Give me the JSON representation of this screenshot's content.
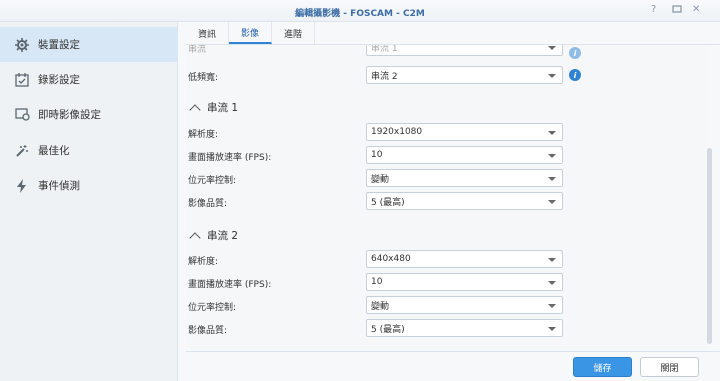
{
  "window": {
    "title": "編輯攝影機 - FOSCAM - C2M",
    "help": "?",
    "minimize": "—",
    "close": "✕"
  },
  "sidebar": {
    "items": [
      {
        "label": "裝置設定",
        "icon": "gear-icon",
        "active": true
      },
      {
        "label": "錄影設定",
        "icon": "calendar-check-icon",
        "active": false
      },
      {
        "label": "即時影像設定",
        "icon": "live-view-icon",
        "active": false
      },
      {
        "label": "最佳化",
        "icon": "magic-wand-icon",
        "active": false
      },
      {
        "label": "事件偵測",
        "icon": "lightning-icon",
        "active": false
      }
    ]
  },
  "tabs": [
    "資訊",
    "影像",
    "進階"
  ],
  "active_tab": "影像",
  "top": {
    "partial_label": "串流",
    "partial_value": "串流 1",
    "low_bw_label": "低頻寬:",
    "low_bw_value": "串流 2"
  },
  "stream1": {
    "title": "串流 1",
    "resolution_label": "解析度:",
    "resolution": "1920x1080",
    "fps_label": "畫面播放速率 (FPS):",
    "fps": "10",
    "bitrate_label": "位元率控制:",
    "bitrate": "變動",
    "quality_label": "影像品質:",
    "quality": "5 (最高)"
  },
  "stream2": {
    "title": "串流 2",
    "resolution_label": "解析度:",
    "resolution": "640x480",
    "fps_label": "畫面播放速率 (FPS):",
    "fps": "10",
    "bitrate_label": "位元率控制:",
    "bitrate": "變動",
    "quality_label": "影像品質:",
    "quality": "5 (最高)"
  },
  "footer": {
    "save": "儲存",
    "close": "關閉"
  },
  "colors": {
    "accent": "#3a96e4",
    "title": "#3d6ea6",
    "sidebar_active": "#d7e7f5"
  }
}
